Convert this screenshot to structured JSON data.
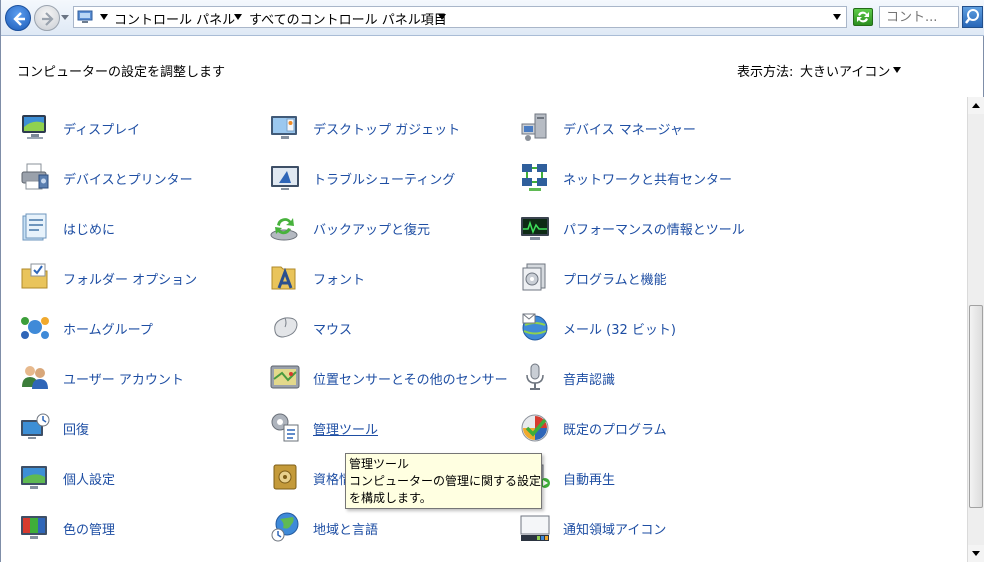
{
  "address_bar": {
    "breadcrumbs": [
      "コントロール パネル",
      "すべてのコントロール パネル項目"
    ],
    "search_placeholder": "コント..."
  },
  "header": {
    "title": "コンピューターの設定を調整します",
    "view_by_label": "表示方法:",
    "view_by_value": "大きいアイコン"
  },
  "items": [
    {
      "label": "ディスプレイ",
      "icon": "display-icon"
    },
    {
      "label": "デスクトップ ガジェット",
      "icon": "gadgets-icon"
    },
    {
      "label": "デバイス マネージャー",
      "icon": "device-manager-icon"
    },
    {
      "label": "デバイスとプリンター",
      "icon": "printer-icon"
    },
    {
      "label": "トラブルシューティング",
      "icon": "troubleshooting-icon"
    },
    {
      "label": "ネットワークと共有センター",
      "icon": "network-icon"
    },
    {
      "label": "はじめに",
      "icon": "getting-started-icon"
    },
    {
      "label": "バックアップと復元",
      "icon": "backup-icon"
    },
    {
      "label": "パフォーマンスの情報とツール",
      "icon": "performance-icon"
    },
    {
      "label": "フォルダー オプション",
      "icon": "folder-options-icon"
    },
    {
      "label": "フォント",
      "icon": "fonts-icon"
    },
    {
      "label": "プログラムと機能",
      "icon": "programs-icon"
    },
    {
      "label": "ホームグループ",
      "icon": "homegroup-icon"
    },
    {
      "label": "マウス",
      "icon": "mouse-icon"
    },
    {
      "label": "メール (32 ビット)",
      "icon": "mail-icon"
    },
    {
      "label": "ユーザー アカウント",
      "icon": "user-accounts-icon"
    },
    {
      "label": "位置センサーとその他のセンサー",
      "icon": "location-sensors-icon"
    },
    {
      "label": "音声認識",
      "icon": "microphone-icon"
    },
    {
      "label": "回復",
      "icon": "recovery-icon"
    },
    {
      "label": "管理ツール",
      "icon": "admin-tools-icon"
    },
    {
      "label": "既定のプログラム",
      "icon": "default-programs-icon"
    },
    {
      "label": "個人設定",
      "icon": "personalization-icon"
    },
    {
      "label": "資格情",
      "icon": "credential-manager-icon"
    },
    {
      "label": "自動再生",
      "icon": "autoplay-icon"
    },
    {
      "label": "色の管理",
      "icon": "color-management-icon"
    },
    {
      "label": "地域と言語",
      "icon": "region-language-icon"
    },
    {
      "label": "通知領域アイコン",
      "icon": "notification-area-icon"
    }
  ],
  "tooltip": {
    "lines": [
      "管理ツール",
      "コンピューターの管理に関する設定",
      "を構成します。"
    ]
  },
  "colors": {
    "link": "#1e4ea3",
    "tooltip_bg": "#ffffe1"
  }
}
